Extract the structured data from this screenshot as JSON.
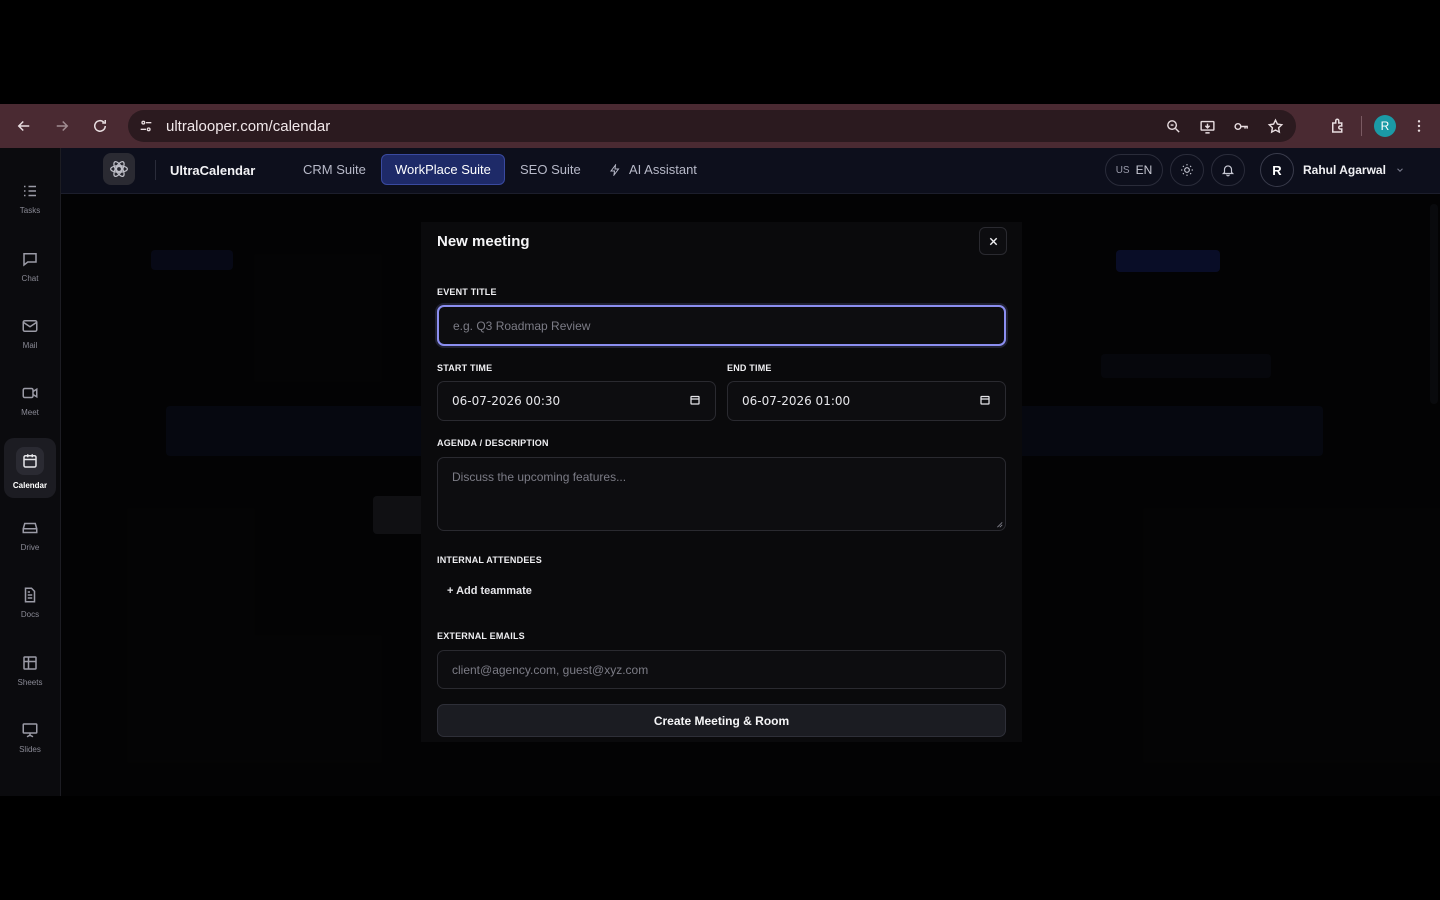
{
  "browser": {
    "url": "ultralooper.com/calendar",
    "profile_initial": "R"
  },
  "sidebar": {
    "items": [
      {
        "label": "Tasks",
        "icon": "tasks-icon"
      },
      {
        "label": "Chat",
        "icon": "chat-icon"
      },
      {
        "label": "Mail",
        "icon": "mail-icon"
      },
      {
        "label": "Meet",
        "icon": "video-icon"
      },
      {
        "label": "Calendar",
        "icon": "calendar-icon",
        "active": true
      },
      {
        "label": "Drive",
        "icon": "drive-icon"
      },
      {
        "label": "Docs",
        "icon": "docs-icon"
      },
      {
        "label": "Sheets",
        "icon": "sheets-icon"
      },
      {
        "label": "Slides",
        "icon": "slides-icon"
      }
    ]
  },
  "topnav": {
    "brand": "UltraCalendar",
    "tabs": [
      {
        "label": "CRM Suite"
      },
      {
        "label": "WorkPlace Suite",
        "active": true
      },
      {
        "label": "SEO Suite"
      },
      {
        "label": "AI Assistant"
      }
    ],
    "language": {
      "flag": "US",
      "code": "EN"
    },
    "user": {
      "initial": "R",
      "name": "Rahul Agarwal"
    }
  },
  "modal": {
    "title": "New meeting",
    "event_title_label": "EVENT TITLE",
    "event_title_placeholder": "e.g. Q3 Roadmap Review",
    "start_time_label": "START TIME",
    "start_time_value": "06-07-2026 00:30",
    "end_time_label": "END TIME",
    "end_time_value": "06-07-2026 01:00",
    "agenda_label": "AGENDA / DESCRIPTION",
    "agenda_placeholder": "Discuss the upcoming features...",
    "attendees_label": "INTERNAL ATTENDEES",
    "add_teammate_label": "+ Add teammate",
    "external_label": "EXTERNAL EMAILS",
    "external_placeholder": "client@agency.com, guest@xyz.com",
    "submit_label": "Create Meeting & Room"
  },
  "colors": {
    "accent": "#8b8ef0",
    "active_tab": "#1e2a68",
    "chrome": "#4a2a32"
  }
}
